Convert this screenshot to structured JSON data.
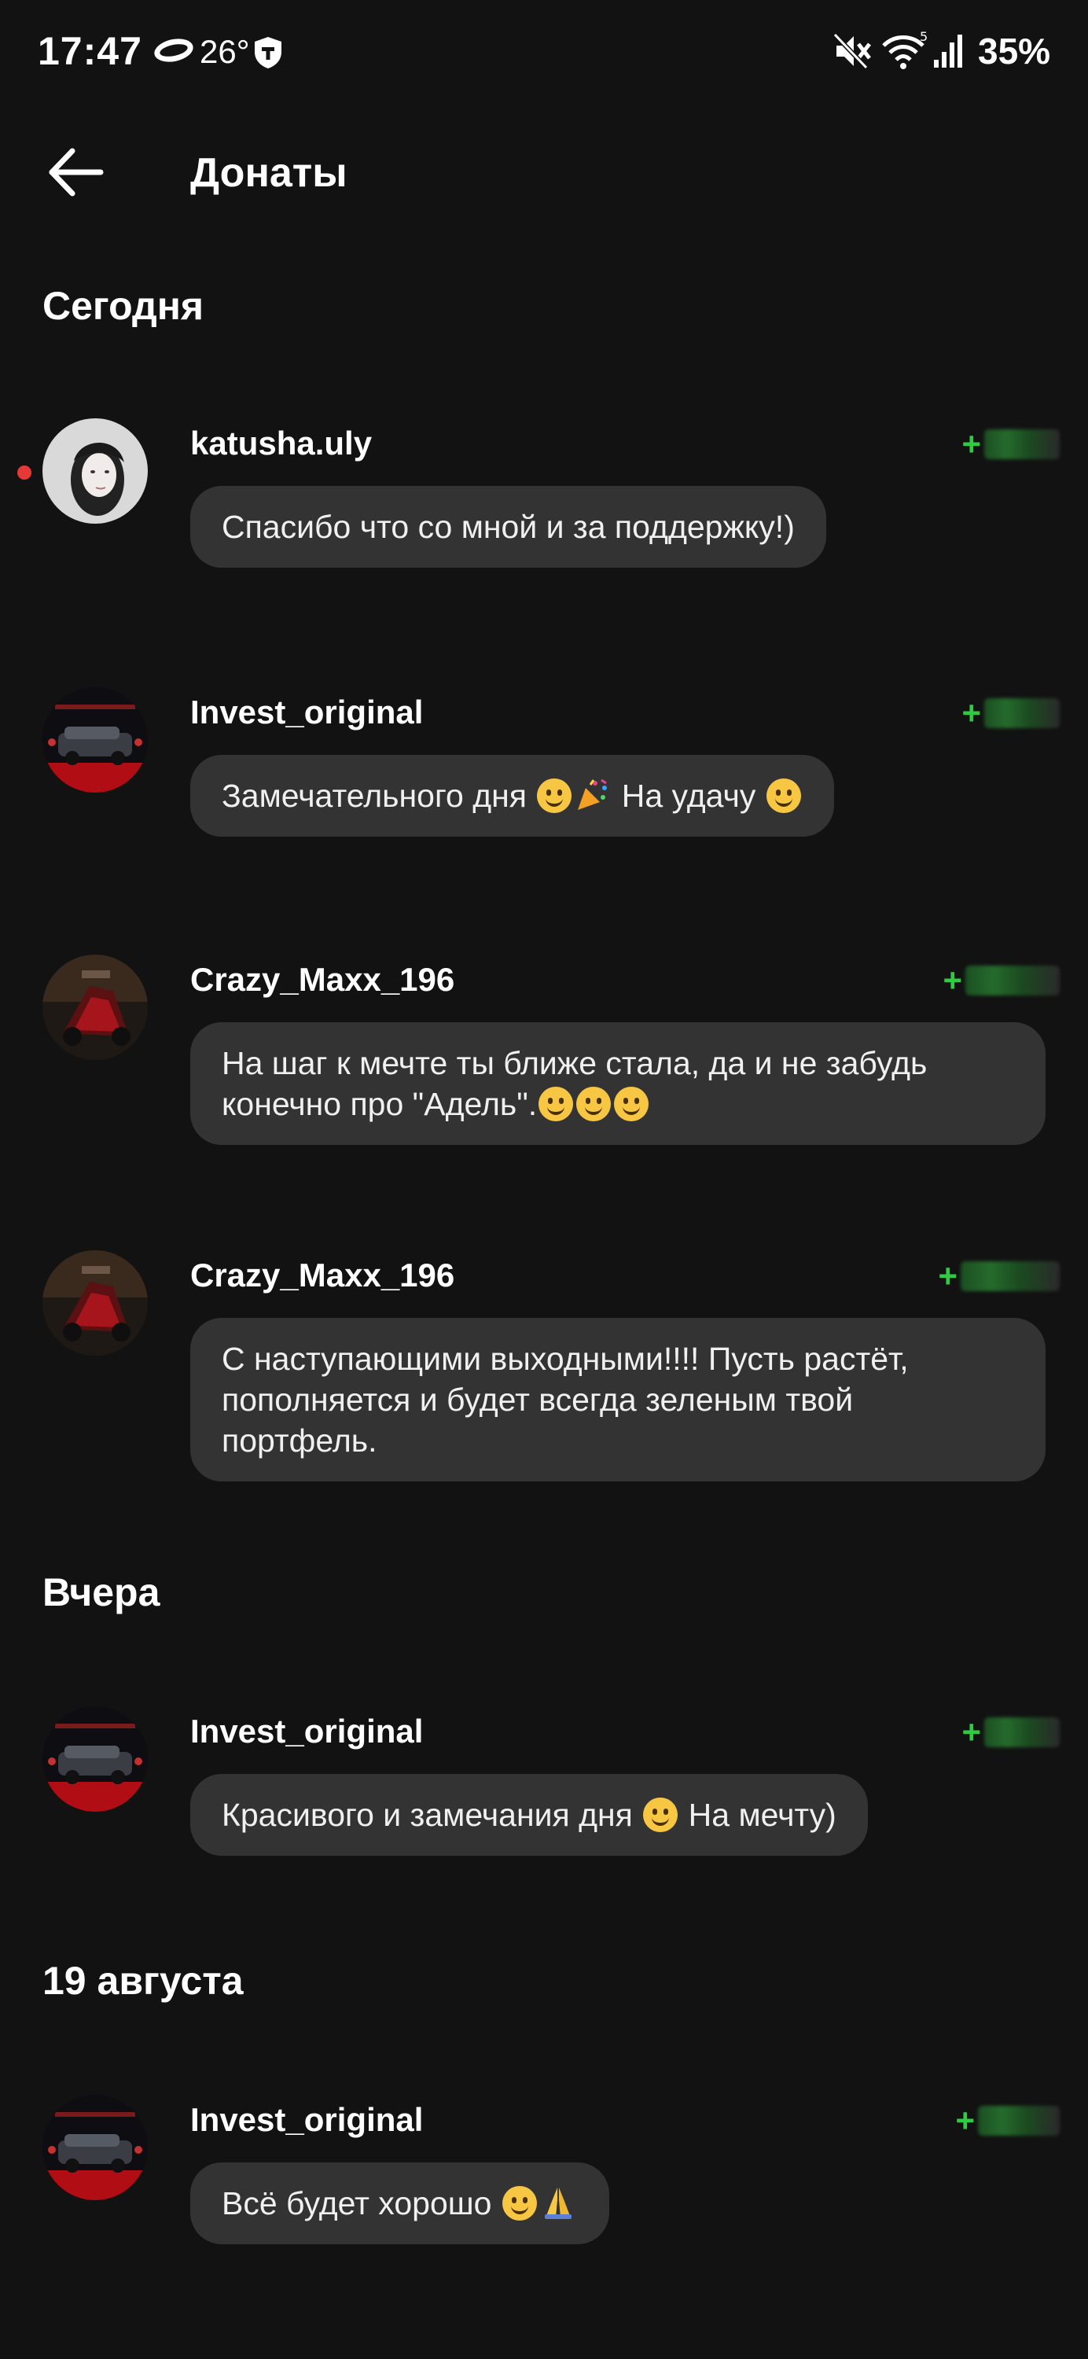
{
  "status_bar": {
    "time": "17:47",
    "temperature": "26°",
    "battery": "35%"
  },
  "header": {
    "title": "Донаты"
  },
  "sections": [
    {
      "title": "Сегодня",
      "items": [
        {
          "username": "katusha.uly",
          "amount_sign": "+",
          "message": "Спасибо что со мной и за поддержку!)",
          "unread": true
        },
        {
          "username": "Invest_original",
          "amount_sign": "+",
          "message_parts": [
            "Замечательного дня ",
            " На удачу "
          ]
        },
        {
          "username": "Crazy_Maxx_196",
          "amount_sign": "+",
          "message": "На шаг к мечте ты ближе стала, да и не забудь конечно про \"Адель\"."
        },
        {
          "username": "Crazy_Maxx_196",
          "amount_sign": "+",
          "message": "С наступающими выходными!!!! Пусть растёт, пополняется и будет всегда зеленым твой портфель."
        }
      ]
    },
    {
      "title": "Вчера",
      "items": [
        {
          "username": "Invest_original",
          "amount_sign": "+",
          "message_parts": [
            "Красивого и замечания дня ",
            "  На мечту)"
          ]
        }
      ]
    },
    {
      "title": "19 августа",
      "items": [
        {
          "username": "Invest_original",
          "amount_sign": "+",
          "message": "Всё будет хорошо "
        }
      ]
    }
  ],
  "colors": {
    "background": "#121212",
    "bubble": "#333333",
    "amount_accent": "#2ecc40",
    "unread_dot": "#e53935"
  },
  "icons": [
    "back-arrow-icon",
    "cloud-icon",
    "shield-icon",
    "mute-icon",
    "wifi-icon",
    "signal-icon"
  ]
}
